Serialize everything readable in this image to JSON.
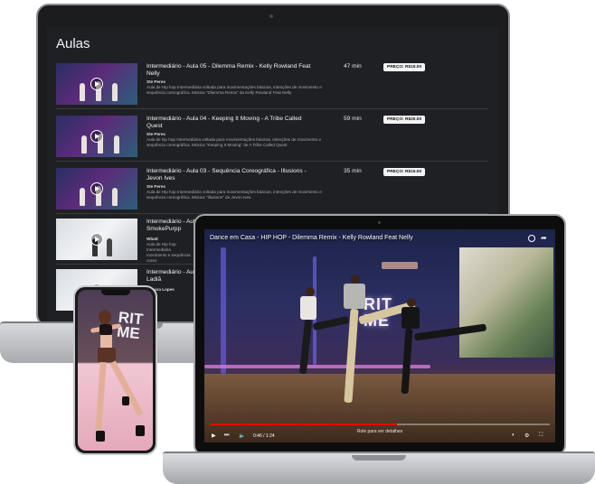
{
  "lessons_page": {
    "title": "Aulas",
    "lessons": [
      {
        "title": "Intermediário - Aula 05 - Dilemma Remix - Kelly Rowland Feat Nelly",
        "author": "Ste Peres",
        "description": "Aula de Hip hop Intermediária voltada para movimentações básicas, intenções de movimento e sequência coreográfica. Música \"Dilemma Remix\" da Kelly Rowland Feat Nelly",
        "duration": "47 min",
        "price": "PREÇO: R$15.00",
        "thumb_caption": ""
      },
      {
        "title": "Intermediário - Aula 04 - Keeping It Moving - A Tribe Called Quest",
        "author": "Ste Peres",
        "description": "Aula de hip hop Intermediária voltada para movimentações básicas, intenções de movimento e sequência coreográfica. Música \"Keeping It Moving\" de A Tribe Called Quest.",
        "duration": "59 min",
        "price": "PREÇO: R$20.00",
        "thumb_caption": ""
      },
      {
        "title": "Intermediário - Aula 03 - Sequência Coreográfica - Illusions - Jevon Ives",
        "author": "Ste Peres",
        "description": "Aula de Hip hop Intermediária voltada para movimentações básicas, intenções de movimento e sequência coreográfica. Música \"Illusions\" de Jevon Ives.",
        "duration": "35 min",
        "price": "PREÇO: R$15.00",
        "thumb_caption": ""
      },
      {
        "title": "Intermediário - Aul",
        "title_line2": "SmokePurpp",
        "author": "Wbatt",
        "description": "Aula de Hip hop Intermediária movimento e sequência coreo",
        "duration": "",
        "price": "",
        "thumb_caption": ""
      },
      {
        "title": "Intermediário - Aul",
        "title_line2": "Ladiã",
        "author": "Tamara Lopes",
        "description": "",
        "duration": "",
        "price": "",
        "thumb_caption": ""
      }
    ]
  },
  "video_player": {
    "title": "Dance em Casa - HIP HOP - Dilemma Remix - Kelly Rowland Feat Nelly",
    "time": "0:46 / 1:24",
    "subtitle_hint": "Role para ver detalhes",
    "progress": 0.55,
    "wall_logo": "RIT\nME"
  },
  "phone": {
    "wall_logo": "RIT\nME"
  },
  "icons": {
    "play": "play-icon",
    "next": "next-icon",
    "volume": "volume-icon",
    "settings": "gear-icon",
    "fullscreen": "fullscreen-icon",
    "share": "share-icon",
    "watch_later": "clock-icon"
  },
  "colors": {
    "screen_bg": "#1f2023",
    "progress": "#ff0000",
    "price_badge_bg": "#f4f4f4"
  }
}
